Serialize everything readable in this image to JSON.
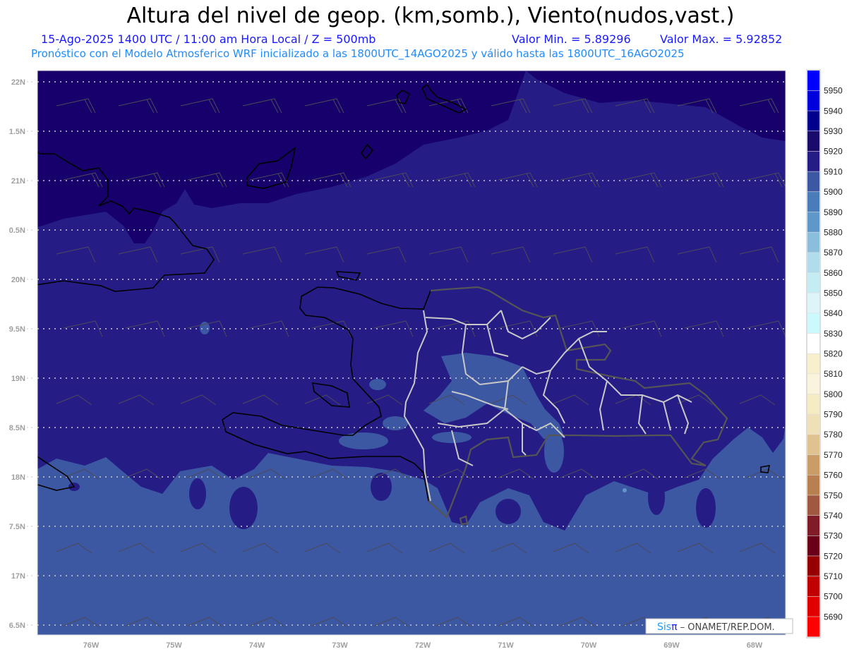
{
  "header": {
    "title": "Altura del nivel de geop. (km,somb.), Viento(nudos,vast.)",
    "subtitle_1": "15-Ago-2025  1400 UTC / 11:00 am Hora Local / Z = 500mb",
    "min_value": "Valor Min. = 5.89296",
    "max_value": "Valor Max. = 5.92852",
    "subtitle_2": "Pronóstico con el Modelo Atmosferico WRF inicializado a las 1800UTC_14AGO2025 y válido hasta las  1800UTC_16AGO2025"
  },
  "map": {
    "lat_labels": [
      "22N",
      "1.5N",
      "21N",
      "0.5N",
      "20N",
      "9.5N",
      "19N",
      "8.5N",
      "18N",
      "7.5N",
      "17N",
      "6.5N"
    ],
    "lon_labels": [
      "76W",
      "75W",
      "74W",
      "73W",
      "72W",
      "71W",
      "70W",
      "69W",
      "68W"
    ],
    "fill_colors": {
      "dark": "#17006b",
      "mid": "#261c86",
      "light": "#3d58a3",
      "lighter": "#4a7cb9"
    }
  },
  "colorbar": {
    "labels": [
      "5950",
      "5940",
      "5930",
      "5920",
      "5910",
      "5900",
      "5890",
      "5880",
      "5870",
      "5860",
      "5850",
      "5840",
      "5830",
      "5820",
      "5810",
      "5800",
      "5790",
      "5780",
      "5770",
      "5760",
      "5750",
      "5740",
      "5730",
      "5720",
      "5710",
      "5700",
      "5690"
    ],
    "colors": [
      "#0000ff",
      "#0000dc",
      "#00008c",
      "#1a0a6c",
      "#261c86",
      "#3d58a3",
      "#4a7cb9",
      "#5f97c8",
      "#8bbedc",
      "#b0dceb",
      "#c4ecf3",
      "#ddf4f8",
      "#ccf9fb",
      "#ffffff",
      "#f8f0cc",
      "#faf4de",
      "#f6ecc4",
      "#efe0b8",
      "#dfc290",
      "#c99c68",
      "#b88050",
      "#a05840",
      "#801c28",
      "#6a0018",
      "#960000",
      "#c00000",
      "#e00000",
      "#ff0000"
    ]
  },
  "credit": {
    "sis": "Sis",
    "pi": "π",
    "org": " – ONAMET/REP.DOM."
  }
}
